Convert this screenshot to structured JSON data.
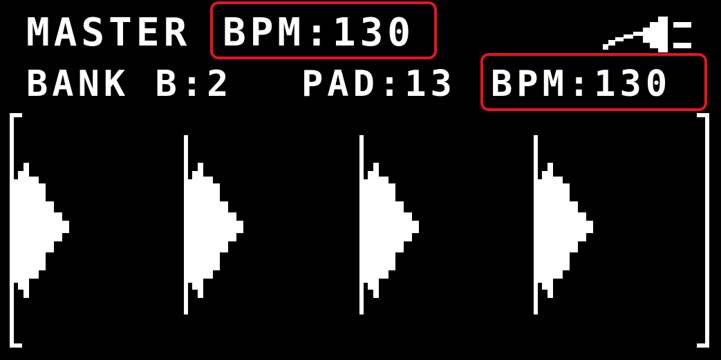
{
  "header": {
    "master_label": "MASTER",
    "master_bpm": "BPM:130",
    "bank_label": "BANK B:2",
    "pad_label": "PAD:13",
    "pad_bpm": "BPM:130"
  },
  "indicators": {
    "power_icon": "power-plug-icon"
  },
  "colors": {
    "background": "#000000",
    "foreground": "#ffffff",
    "highlight": "#e8141c"
  }
}
